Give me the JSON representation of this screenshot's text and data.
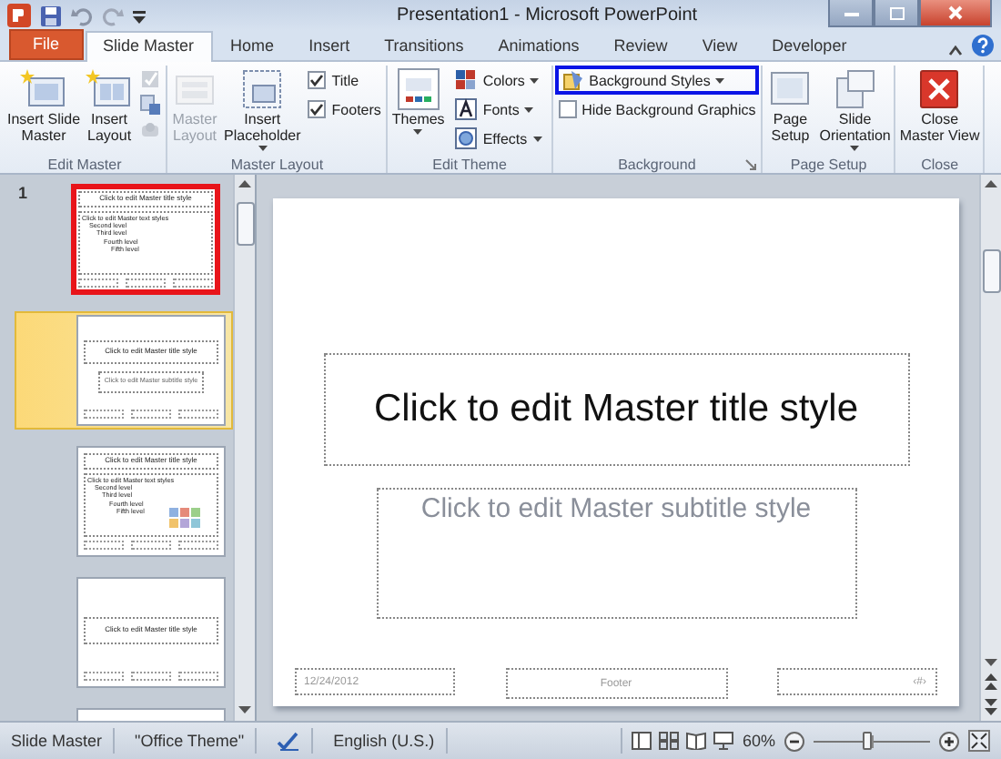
{
  "window": {
    "title": "Presentation1 - Microsoft PowerPoint"
  },
  "tabs": [
    {
      "label": "File",
      "kind": "file",
      "selected": false
    },
    {
      "label": "Slide Master",
      "kind": "tab",
      "selected": true
    },
    {
      "label": "Home",
      "kind": "tab",
      "selected": false
    },
    {
      "label": "Insert",
      "kind": "tab",
      "selected": false
    },
    {
      "label": "Transitions",
      "kind": "tab",
      "selected": false
    },
    {
      "label": "Animations",
      "kind": "tab",
      "selected": false
    },
    {
      "label": "Review",
      "kind": "tab",
      "selected": false
    },
    {
      "label": "View",
      "kind": "tab",
      "selected": false
    },
    {
      "label": "Developer",
      "kind": "tab",
      "selected": false
    }
  ],
  "ribbon_groups": [
    {
      "label": "Edit Master",
      "columns": [
        [
          {
            "kind": "large",
            "label": "Insert Slide\nMaster",
            "disabled": false
          }
        ],
        [
          {
            "kind": "large",
            "label": "Insert\nLayout",
            "disabled": false
          }
        ],
        [
          {
            "kind": "tools",
            "disabled": true
          }
        ]
      ]
    },
    {
      "label": "Master Layout",
      "columns": [
        [
          {
            "kind": "large",
            "label": "Master\nLayout",
            "disabled": true
          }
        ],
        [
          {
            "kind": "large",
            "label": "Insert\nPlaceholder",
            "dropdown": true,
            "disabled": false
          }
        ],
        [
          {
            "kind": "check",
            "label": "Title",
            "checked": true
          },
          {
            "kind": "check",
            "label": "Footers",
            "checked": true
          }
        ]
      ]
    },
    {
      "label": "Edit Theme",
      "columns": [
        [
          {
            "kind": "large",
            "label": "Themes",
            "dropdown": true,
            "disabled": false
          }
        ],
        [
          {
            "kind": "small",
            "label": "Colors",
            "dropdown": true,
            "highlight": false
          },
          {
            "kind": "small",
            "label": "Fonts",
            "dropdown": true,
            "highlight": false
          },
          {
            "kind": "small",
            "label": "Effects",
            "dropdown": true,
            "highlight": false
          }
        ]
      ]
    },
    {
      "label": "Background",
      "launcher": true,
      "columns": [
        [
          {
            "kind": "small",
            "label": "Background Styles",
            "dropdown": true,
            "highlight": true
          },
          {
            "kind": "check",
            "label": "Hide Background Graphics",
            "checked": false
          }
        ]
      ]
    },
    {
      "label": "Page Setup",
      "columns": [
        [
          {
            "kind": "large",
            "label": "Page\nSetup",
            "disabled": false
          }
        ],
        [
          {
            "kind": "large",
            "label": "Slide\nOrientation",
            "dropdown": true,
            "disabled": false
          }
        ]
      ]
    },
    {
      "label": "Close",
      "columns": [
        [
          {
            "kind": "large",
            "label": "Close\nMaster View",
            "disabled": false
          }
        ]
      ]
    }
  ],
  "thumbnails": [
    {
      "kind": "master",
      "number": "1",
      "selected": false,
      "annotated": true,
      "title": "Click to edit Master title style",
      "body": [
        "Click to edit Master text styles",
        "Second level",
        "Third level",
        "Fourth level",
        "Fifth level"
      ]
    },
    {
      "kind": "title",
      "selected": true,
      "annotated": false,
      "title": "Click to edit Master title style",
      "subtitle": "Click to edit Master subtitle style"
    },
    {
      "kind": "content",
      "selected": false,
      "annotated": false,
      "title": "Click to edit Master title style",
      "body": [
        "Click to edit Master text styles",
        "Second level",
        "Third level",
        "Fourth level",
        "Fifth level"
      ]
    },
    {
      "kind": "section",
      "selected": false,
      "annotated": false,
      "title": "Click to edit Master title style"
    },
    {
      "kind": "partial",
      "selected": false,
      "annotated": false
    }
  ],
  "slide": {
    "title": "Click to edit Master title style",
    "subtitle": "Click to edit Master subtitle style",
    "date": "12/24/2012",
    "footer": "Footer",
    "page_number": "‹#›"
  },
  "status_bar": {
    "view": "Slide Master",
    "theme": "\"Office Theme\"",
    "language": "English (U.S.)",
    "zoom": {
      "reading": "60%",
      "level": 0.45
    }
  }
}
